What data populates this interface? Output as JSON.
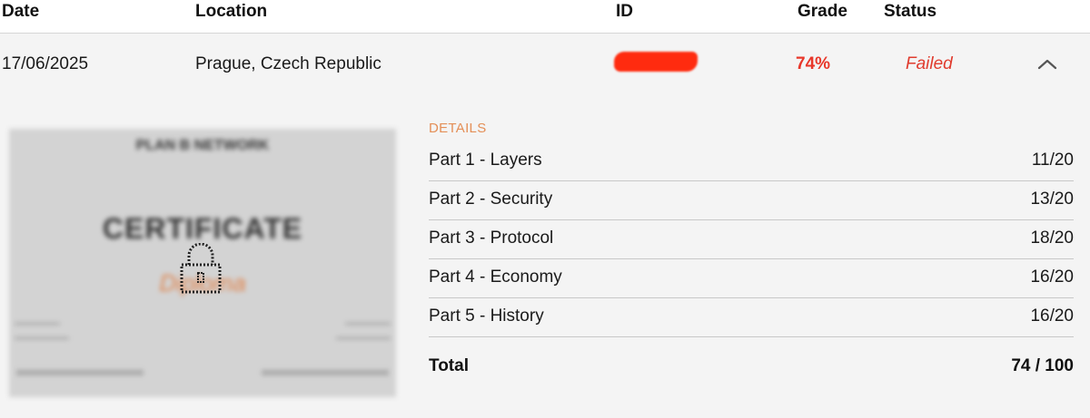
{
  "table": {
    "headers": {
      "date": "Date",
      "location": "Location",
      "id": "ID",
      "grade": "Grade",
      "status": "Status"
    },
    "row": {
      "date": "17/06/2025",
      "location": "Prague, Czech Republic",
      "grade": "74%",
      "status": "Failed",
      "expand_icon": "chevron-up-icon"
    }
  },
  "certificate": {
    "logo_text": "PLAN B NETWORK",
    "title": "CERTIFICATE",
    "signature": "Diploma",
    "lock_icon": "lock-icon"
  },
  "details": {
    "label": "DETAILS",
    "items": [
      {
        "name": "Part 1 - Layers",
        "score": "11/20"
      },
      {
        "name": "Part 2 - Security",
        "score": "13/20"
      },
      {
        "name": "Part 3 - Protocol",
        "score": "18/20"
      },
      {
        "name": "Part 4 - Economy",
        "score": "16/20"
      },
      {
        "name": "Part 5 - History",
        "score": "16/20"
      }
    ],
    "total_label": "Total",
    "total_score": "74 / 100"
  },
  "colors": {
    "grade_red": "#e8372a",
    "status_red": "#e03b2e",
    "details_orange": "#e48f57",
    "redaction": "#ff2b0f",
    "row_background": "#f4f4f4"
  }
}
